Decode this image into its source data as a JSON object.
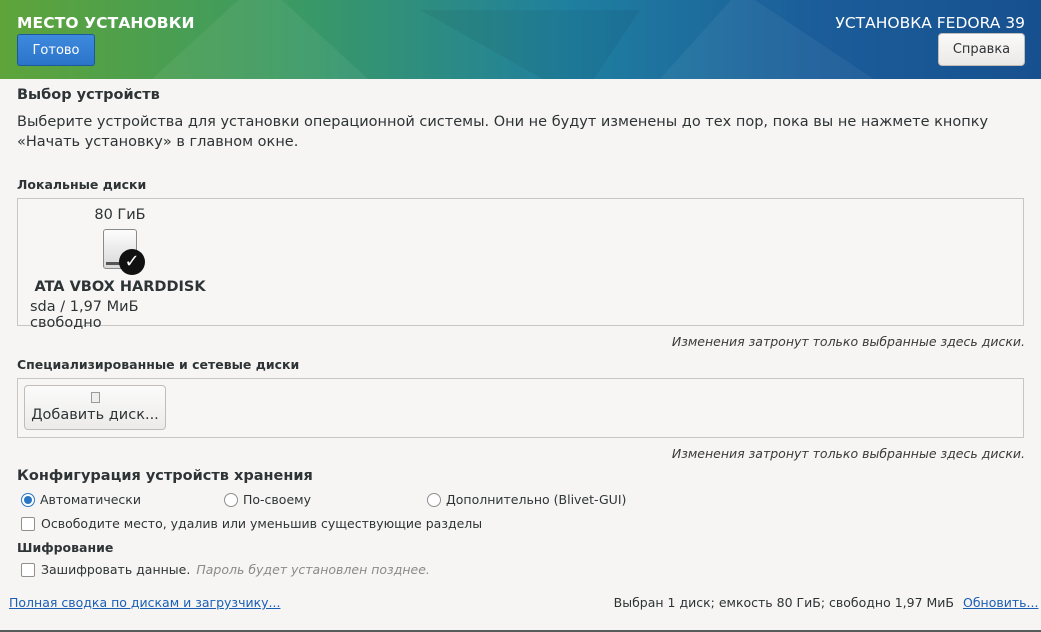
{
  "header": {
    "spoke_title": "МЕСТО УСТАНОВКИ",
    "product_title": "УСТАНОВКА FEDORA 39",
    "done_label": "Готово",
    "help_label": "Справка"
  },
  "device_selection": {
    "title": "Выбор устройств",
    "description": "Выберите устройства для установки операционной системы. Они не будут изменены до тех пор, пока вы не нажмете кнопку «Начать установку» в главном окне."
  },
  "local_disks": {
    "label": "Локальные диски",
    "disks": [
      {
        "size": "80 ГиБ",
        "icon": "harddisk-icon",
        "selected": true,
        "name": "ATA VBOX HARDDISK",
        "info": "sda  /  1,97 МиБ свободно"
      }
    ],
    "note": "Изменения затронут только выбранные здесь диски."
  },
  "specialized_disks": {
    "label": "Специализированные и сетевые диски",
    "add_button": "Добавить диск...",
    "note": "Изменения затронут только выбранные здесь диски."
  },
  "storage_config": {
    "title": "Конфигурация устройств хранения",
    "options": [
      {
        "label": "Автоматически",
        "selected": true
      },
      {
        "label": "По-своему",
        "selected": false
      },
      {
        "label": "Дополнительно (Blivet-GUI)",
        "selected": false
      }
    ],
    "reclaim_label": "Освободите место, удалив или уменьшив существующие разделы"
  },
  "encryption": {
    "title": "Шифрование",
    "checkbox_label": "Зашифровать данные.",
    "hint": "Пароль будет установлен позднее."
  },
  "footer": {
    "summary_link": "Полная сводка по дискам и загрузчику...",
    "status": "Выбран 1 диск; емкость 80 ГиБ; свободно 1,97 МиБ",
    "refresh_link": "Обновить..."
  }
}
